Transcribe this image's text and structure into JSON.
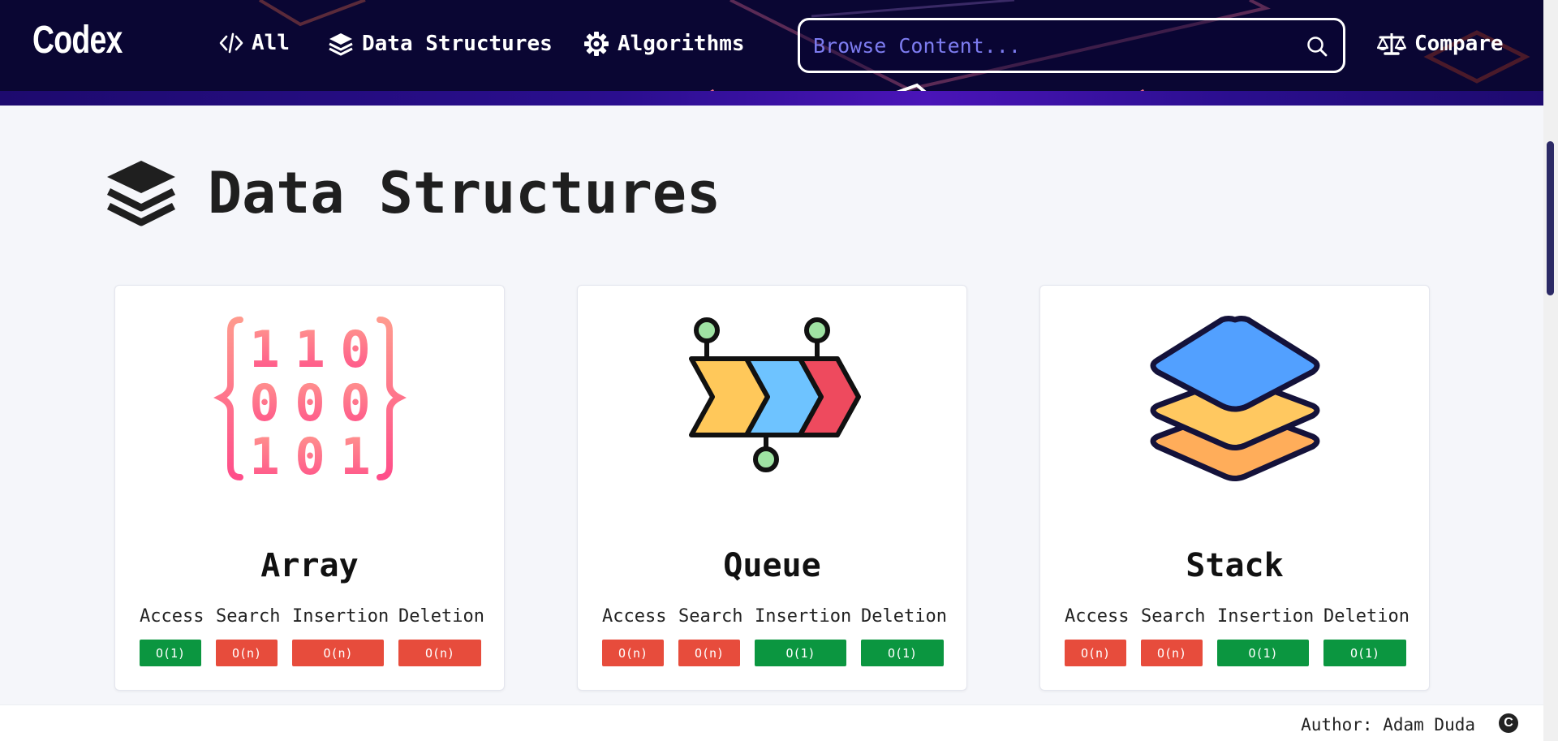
{
  "brand": {
    "logo": "Codex"
  },
  "nav": {
    "all": "All",
    "data_structures": "Data Structures",
    "algorithms": "Algorithms",
    "compare": "Compare"
  },
  "search": {
    "placeholder": "Browse Content...",
    "value": ""
  },
  "page": {
    "title": "Data Structures"
  },
  "cards": [
    {
      "name": "Array",
      "icon": "binary-array-icon",
      "ops": [
        {
          "label": "Access",
          "value": "O(1)",
          "status": "good"
        },
        {
          "label": "Search",
          "value": "O(n)",
          "status": "bad"
        },
        {
          "label": "Insertion",
          "value": "O(n)",
          "status": "bad"
        },
        {
          "label": "Deletion",
          "value": "O(n)",
          "status": "bad"
        }
      ]
    },
    {
      "name": "Queue",
      "icon": "queue-arrows-icon",
      "ops": [
        {
          "label": "Access",
          "value": "O(n)",
          "status": "bad"
        },
        {
          "label": "Search",
          "value": "O(n)",
          "status": "bad"
        },
        {
          "label": "Insertion",
          "value": "O(1)",
          "status": "good"
        },
        {
          "label": "Deletion",
          "value": "O(1)",
          "status": "good"
        }
      ]
    },
    {
      "name": "Stack",
      "icon": "stack-layers-icon",
      "ops": [
        {
          "label": "Access",
          "value": "O(n)",
          "status": "bad"
        },
        {
          "label": "Search",
          "value": "O(n)",
          "status": "bad"
        },
        {
          "label": "Insertion",
          "value": "O(1)",
          "status": "good"
        },
        {
          "label": "Deletion",
          "value": "O(1)",
          "status": "good"
        }
      ]
    }
  ],
  "footer": {
    "author": "Author: Adam Duda",
    "copyright_symbol": "C"
  },
  "colors": {
    "good": "#0b9640",
    "bad": "#e74c3c",
    "header_bg": "#0a0633",
    "search_placeholder": "#7d7cf0"
  }
}
